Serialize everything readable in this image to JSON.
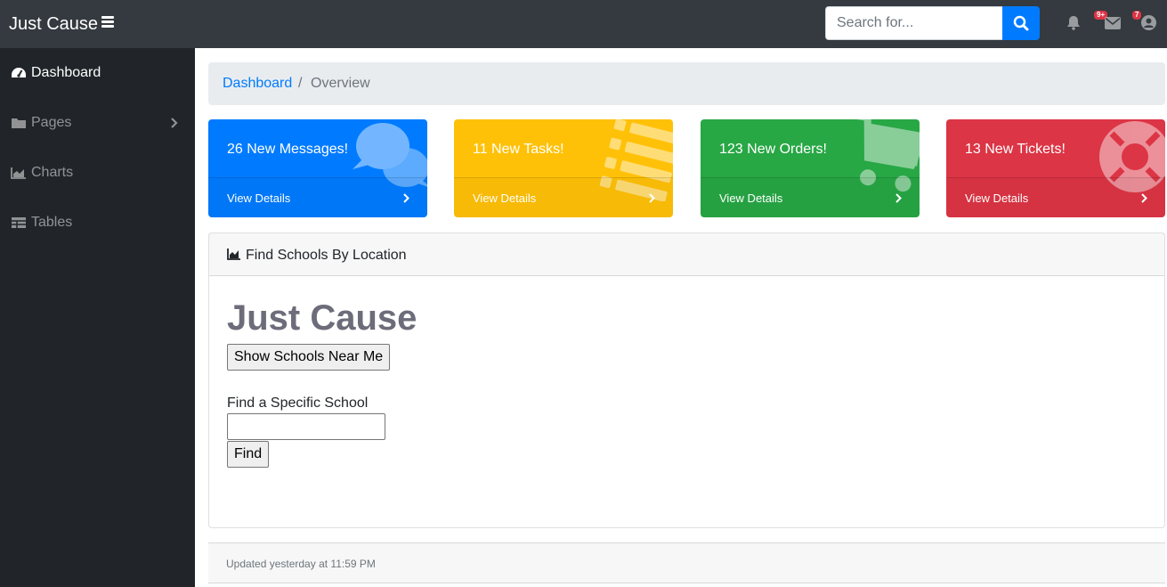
{
  "navbar": {
    "brand": "Just Cause",
    "search_placeholder": "Search for...",
    "alerts_badge": "9+",
    "messages_badge": "7"
  },
  "sidebar": {
    "items": [
      {
        "label": "Dashboard",
        "icon": "tachometer-icon",
        "active": true
      },
      {
        "label": "Pages",
        "icon": "folder-icon",
        "has_submenu": true
      },
      {
        "label": "Charts",
        "icon": "area-chart-icon"
      },
      {
        "label": "Tables",
        "icon": "table-icon"
      }
    ]
  },
  "breadcrumb": {
    "link": "Dashboard",
    "separator": "/",
    "current": "Overview"
  },
  "cards": [
    {
      "title": "26 New Messages!",
      "link": "View Details",
      "color": "#007bff",
      "icon": "comments-icon"
    },
    {
      "title": "11 New Tasks!",
      "link": "View Details",
      "color": "#ffc107",
      "icon": "list-icon"
    },
    {
      "title": "123 New Orders!",
      "link": "View Details",
      "color": "#28a745",
      "icon": "shopping-cart-icon"
    },
    {
      "title": "13 New Tickets!",
      "link": "View Details",
      "color": "#dc3545",
      "icon": "life-ring-icon"
    }
  ],
  "panel": {
    "header": "Find Schools By Location",
    "app_title": "Just Cause",
    "near_button": "Show Schools Near Me",
    "find_label": "Find a Specific School",
    "find_button": "Find"
  },
  "footer": {
    "updated": "Updated yesterday at 11:59 PM"
  }
}
